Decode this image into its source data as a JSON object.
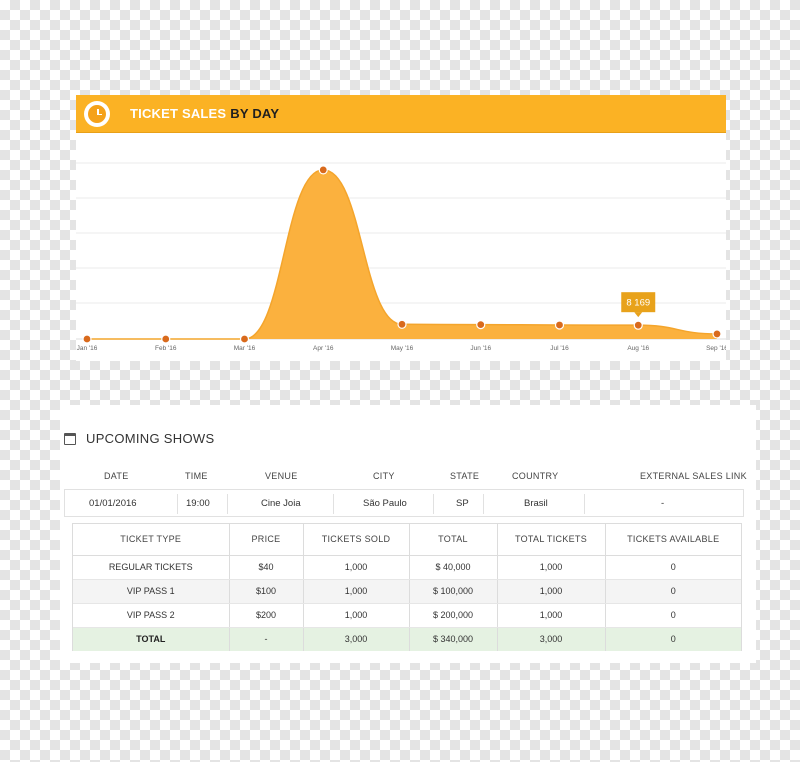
{
  "chart_panel": {
    "title_highlight": "TICKET SALES",
    "title_rest": "BY DAY",
    "icon": "clock-icon"
  },
  "chart_data": {
    "type": "area",
    "title": "TICKET SALES BY DAY",
    "x": [
      "Jan '16",
      "Feb '16",
      "Mar '16",
      "Apr '16",
      "May '16",
      "Jun '16",
      "Jul '16",
      "Aug '16",
      "Sep '16"
    ],
    "series": [
      {
        "values": [
          0,
          0,
          0,
          100000,
          8700,
          8500,
          8300,
          8169,
          3000
        ]
      }
    ],
    "ylim": [
      0,
      110000
    ],
    "grid": true,
    "tooltip": {
      "category": "Aug '16",
      "label": "8 169"
    },
    "colors": {
      "area": "#fbb13e",
      "point": "#d96a1c",
      "tooltip": "#e8a21b",
      "grid": "#ebebeb"
    }
  },
  "shows": {
    "title": "UPCOMING SHOWS",
    "icon": "calendar-icon",
    "columns": [
      "DATE",
      "TIME",
      "VENUE",
      "CITY",
      "STATE",
      "COUNTRY",
      "EXTERNAL SALES LINK"
    ],
    "row": {
      "date": "01/01/2016",
      "time": "19:00",
      "venue": "Cine Joia",
      "city": "São Paulo",
      "state": "SP",
      "country": "Brasil",
      "link": "-"
    }
  },
  "tickets": {
    "headers": [
      "TICKET TYPE",
      "PRICE",
      "TICKETS SOLD",
      "TOTAL",
      "TOTAL TICKETS",
      "TICKETS AVAILABLE"
    ],
    "rows": [
      [
        "REGULAR TICKETS",
        "$40",
        "1,000",
        "$ 40,000",
        "1,000",
        "0"
      ],
      [
        "VIP PASS 1",
        "$100",
        "1,000",
        "$ 100,000",
        "1,000",
        "0"
      ],
      [
        "VIP PASS 2",
        "$200",
        "1,000",
        "$ 200,000",
        "1,000",
        "0"
      ]
    ],
    "total": [
      "TOTAL",
      "-",
      "3,000",
      "$ 340,000",
      "3,000",
      "0"
    ]
  },
  "colors": {
    "accent": "#fbb224",
    "total_row": "#e5f2e2"
  }
}
